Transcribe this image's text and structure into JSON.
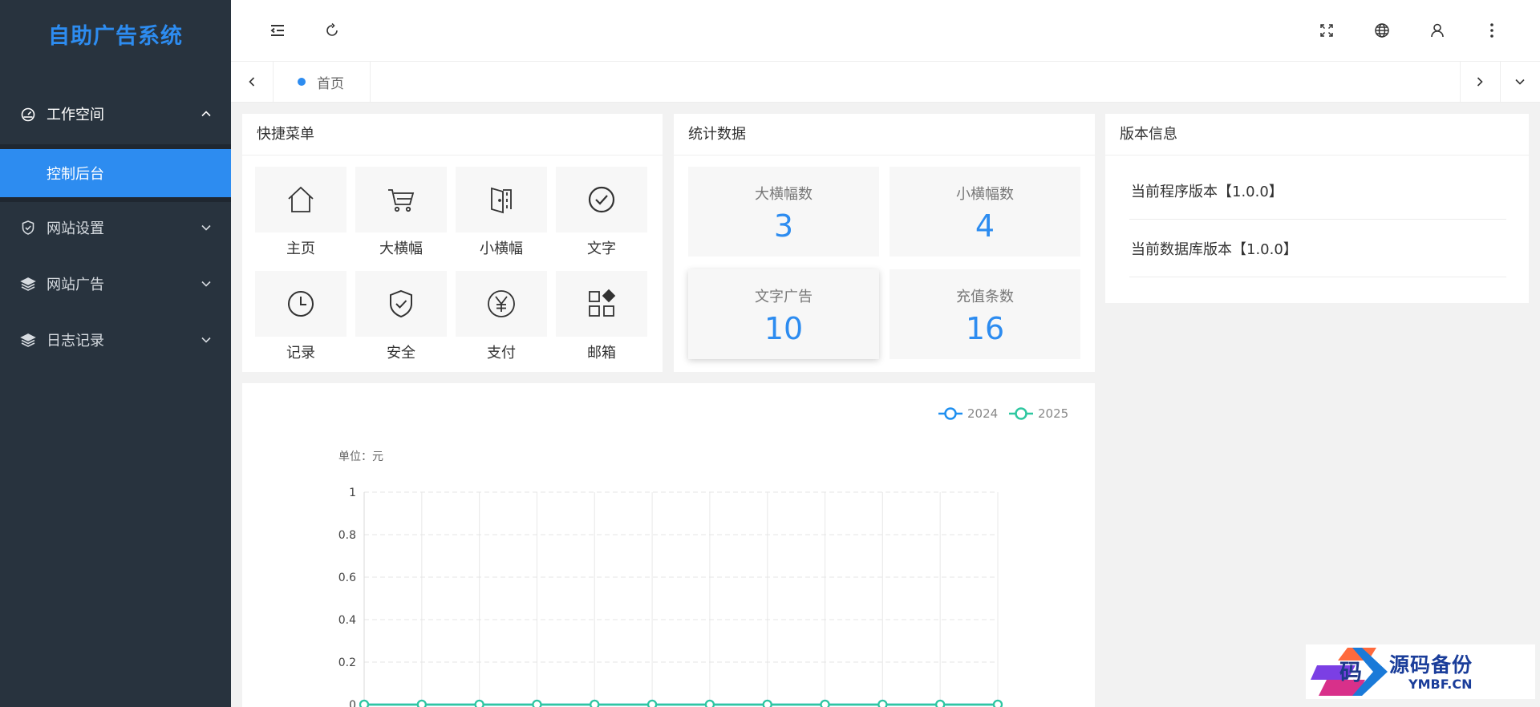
{
  "app": {
    "title": "自助广告系统"
  },
  "sidebar": {
    "groups": [
      {
        "label": "工作空间",
        "icon": "dashboard-icon",
        "expanded": true,
        "children": [
          {
            "label": "控制后台",
            "active": true
          }
        ]
      },
      {
        "label": "网站设置",
        "icon": "shield-check-icon",
        "expanded": false
      },
      {
        "label": "网站广告",
        "icon": "layers-icon",
        "expanded": false
      },
      {
        "label": "日志记录",
        "icon": "layers-icon",
        "expanded": false
      }
    ]
  },
  "header": {
    "left_icons": [
      "menu-fold-icon",
      "refresh-icon"
    ],
    "right_icons": [
      "fullscreen-icon",
      "globe-icon",
      "user-icon",
      "more-vertical-icon"
    ]
  },
  "tabs": {
    "items": [
      {
        "label": "首页",
        "active": true
      }
    ]
  },
  "quick_menu": {
    "title": "快捷菜单",
    "items": [
      {
        "label": "主页",
        "icon": "home-icon"
      },
      {
        "label": "大横幅",
        "icon": "cart-icon"
      },
      {
        "label": "小横幅",
        "icon": "door-icon"
      },
      {
        "label": "文字",
        "icon": "check-circle-icon"
      },
      {
        "label": "记录",
        "icon": "clock-icon"
      },
      {
        "label": "安全",
        "icon": "shield-check-icon"
      },
      {
        "label": "支付",
        "icon": "yen-circle-icon"
      },
      {
        "label": "邮箱",
        "icon": "apps-icon"
      }
    ]
  },
  "stats": {
    "title": "统计数据",
    "items": [
      {
        "label": "大横幅数",
        "value": "3"
      },
      {
        "label": "小横幅数",
        "value": "4"
      },
      {
        "label": "文字广告",
        "value": "10"
      },
      {
        "label": "充值条数",
        "value": "16"
      }
    ]
  },
  "version_info": {
    "title": "版本信息",
    "rows": [
      "当前程序版本【1.0.0】",
      "当前数据库版本【1.0.0】"
    ]
  },
  "chart_data": {
    "type": "line",
    "ylabel": "单位：元",
    "ylim": [
      0,
      1
    ],
    "yticks": [
      "0",
      "0.2",
      "0.4",
      "0.6",
      "0.8",
      "1"
    ],
    "grid": true,
    "legend_position": "top-right",
    "x_count": 12,
    "series": [
      {
        "name": "2024",
        "color": "#1e8ff0",
        "values": [
          0,
          0,
          0,
          0,
          0,
          0,
          0,
          0,
          0,
          0,
          0,
          0
        ]
      },
      {
        "name": "2025",
        "color": "#2ec7a0",
        "values": [
          0,
          0,
          0,
          0,
          0,
          0,
          0,
          0,
          0,
          0,
          0,
          0
        ]
      }
    ]
  },
  "watermark": {
    "text": "源码备份",
    "sub": "YMBF.CN",
    "glyph": "码"
  }
}
